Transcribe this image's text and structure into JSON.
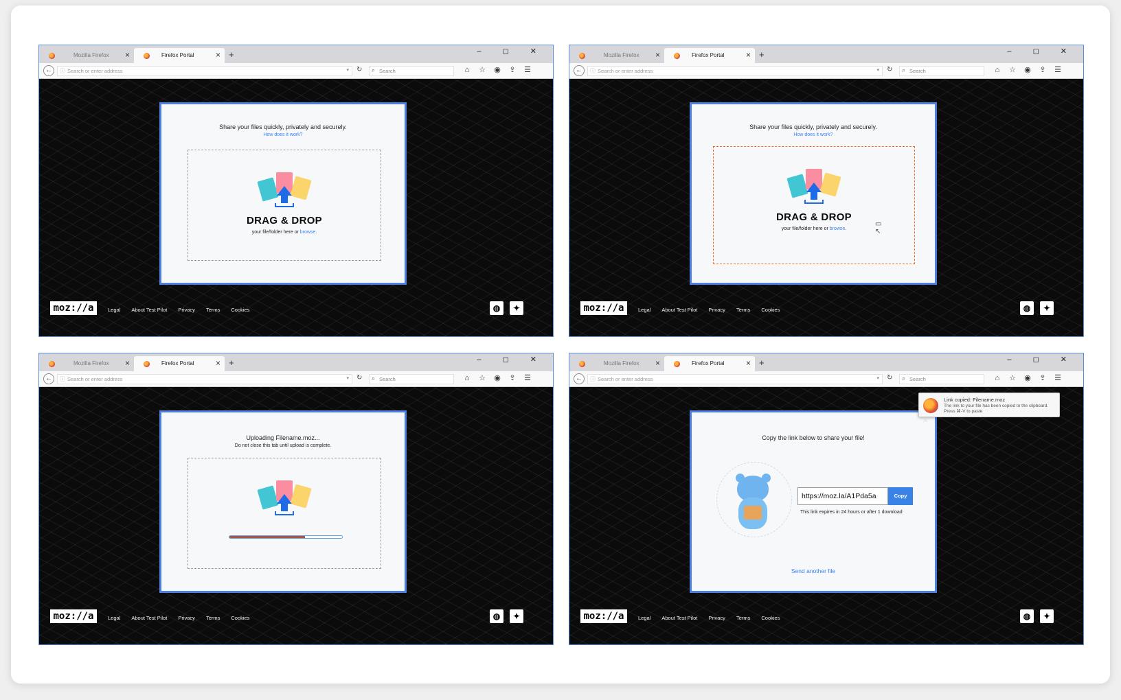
{
  "browser": {
    "tab_inactive": "Mozilla Firefox",
    "tab_active": "Firefox Portal",
    "new_tab": "+",
    "window_controls": "–  ◻  ✕",
    "url_placeholder": "Search or enter address",
    "search_placeholder": "Search"
  },
  "footer": {
    "logo": "moz://a",
    "links": [
      "Legal",
      "About Test Pilot",
      "Privacy",
      "Terms",
      "Cookies"
    ]
  },
  "screens": {
    "upload": {
      "title": "Share your files quickly, privately and securely.",
      "how_link": "How does it work?",
      "drag_title": "DRAG & DROP",
      "drag_sub": "your file/folder here or ",
      "browse": "browse"
    },
    "uploading": {
      "title": "Uploading Filename.moz...",
      "subtitle": "Do not close this tab until upload is complete.",
      "progress": 0.67
    },
    "share": {
      "title": "Copy the link below to share your file!",
      "link": "https://moz.la/A1Pda5a",
      "copy_label": "Copy",
      "expires": "This link expires in 24 hours or after 1 download",
      "send_another": "Send another file",
      "notification_title": "Link copied: Filename.moz",
      "notification_line1": "The link to your file has been copied to the clipboard.",
      "notification_line2": "Press ⌘-V to paste"
    }
  },
  "icons": {
    "github": "github-icon",
    "twitter": "twitter-icon",
    "accent": "#4e7ee0",
    "drop_active": "#f36f22"
  }
}
